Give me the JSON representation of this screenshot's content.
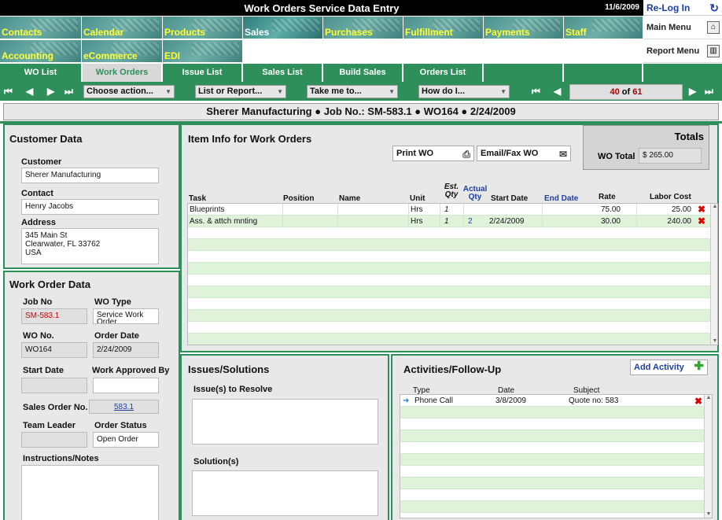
{
  "header": {
    "title": "Work Orders Service Data Entry",
    "date": "11/6/2009",
    "relog_label": "Re-Log In"
  },
  "modules": [
    {
      "label": "Contacts"
    },
    {
      "label": "Calendar"
    },
    {
      "label": "Products"
    },
    {
      "label": "Sales"
    },
    {
      "label": "Purchases"
    },
    {
      "label": "Fulfillment"
    },
    {
      "label": "Payments"
    },
    {
      "label": "Staff"
    },
    {
      "label": "Accounting"
    },
    {
      "label": "eCommerce"
    },
    {
      "label": "EDI"
    }
  ],
  "side_menu": {
    "main_menu": "Main Menu",
    "report_menu": "Report Menu"
  },
  "tabs": [
    {
      "label": "WO List"
    },
    {
      "label": "Work Orders"
    },
    {
      "label": "Issue List"
    },
    {
      "label": "Sales List"
    },
    {
      "label": "Build Sales"
    },
    {
      "label": "Orders List"
    }
  ],
  "toolbar": {
    "choose_action": "Choose action...",
    "list_or_report": "List or Report...",
    "take_me_to": "Take me to...",
    "how_do_i": "How do I...",
    "record_current": "40",
    "record_of": "of",
    "record_total": "61"
  },
  "headline": "Sherer Manufacturing  ●  Job No.: SM-583.1  ●  WO164  ●  2/24/2009",
  "customer": {
    "title": "Customer Data",
    "customer_label": "Customer",
    "customer_value": "Sherer Manufacturing",
    "contact_label": "Contact",
    "contact_value": "Henry  Jacobs",
    "address_label": "Address",
    "address_line1": "345 Main St",
    "address_line2": "Clearwater, FL 33762",
    "address_line3": "USA"
  },
  "work_order": {
    "title": "Work Order Data",
    "job_no_label": "Job No",
    "job_no_value": "SM-583.1",
    "wo_type_label": "WO Type",
    "wo_type_value": "Service Work Order",
    "wo_no_label": "WO No.",
    "wo_no_value": "WO164",
    "order_date_label": "Order Date",
    "order_date_value": "2/24/2009",
    "start_date_label": "Start Date",
    "start_date_value": "",
    "approved_label": "Work Approved By",
    "approved_value": "",
    "sales_order_label": "Sales Order No.",
    "sales_order_value": "583.1",
    "team_leader_label": "Team Leader",
    "team_leader_value": "",
    "status_label": "Order Status",
    "status_value": "Open Order",
    "notes_label": "Instructions/Notes"
  },
  "items": {
    "title": "Item Info for Work Orders",
    "print_label": "Print WO",
    "email_label": "Email/Fax WO",
    "columns": {
      "task": "Task",
      "position": "Position",
      "name": "Name",
      "unit": "Unit",
      "est_qty_1": "Est.",
      "est_qty_2": "Qty",
      "actual_qty_1": "Actual",
      "actual_qty_2": "Qty",
      "start_date": "Start Date",
      "end_date": "End Date",
      "rate": "Rate",
      "labor_cost": "Labor Cost"
    },
    "rows": [
      {
        "task": "Blueprints",
        "unit": "Hrs",
        "est": "1",
        "actual": "",
        "start": "",
        "rate": "75.00",
        "cost": "25.00"
      },
      {
        "task": "Ass. & attch mnting",
        "unit": "Hrs",
        "est": "1",
        "actual": "2",
        "start": "2/24/2009",
        "rate": "30.00",
        "cost": "240.00"
      }
    ]
  },
  "totals": {
    "title": "Totals",
    "wo_total_label": "WO Total",
    "wo_total_value": "$ 265.00"
  },
  "issues": {
    "title": "Issues/Solutions",
    "issues_label": "Issue(s) to Resolve",
    "solutions_label": "Solution(s)"
  },
  "activities": {
    "title": "Activities/Follow-Up",
    "add_label": "Add Activity",
    "col_type": "Type",
    "col_date": "Date",
    "col_subject": "Subject",
    "rows": [
      {
        "type": "Phone Call",
        "date": "3/8/2009",
        "subject": "Quote no: 583"
      }
    ]
  },
  "colors": {
    "accent_green": "#2f8f5a",
    "module_yellow": "#ffff33",
    "link_blue": "#1b3ea4",
    "delete_red": "#dd0000"
  }
}
